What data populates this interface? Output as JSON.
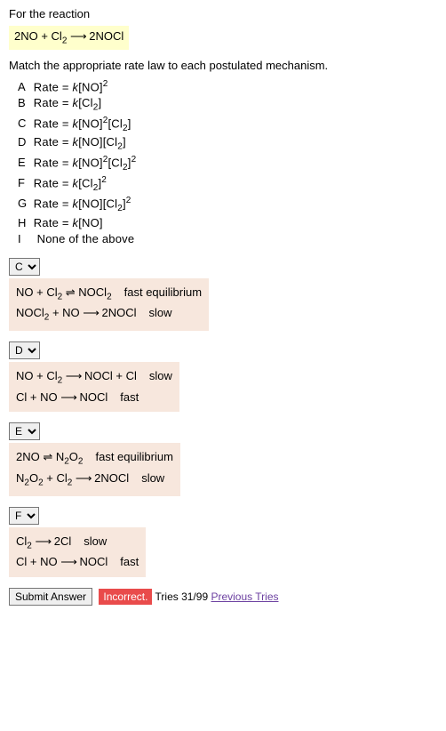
{
  "intro": "For the reaction",
  "reaction": "2NO + Cl₂ ⟶ 2NOCl",
  "instruction": "Match the appropriate rate law to each postulated mechanism.",
  "options": [
    {
      "label": "A",
      "text": "Rate = k[NO]²"
    },
    {
      "label": "B",
      "text": "Rate = k[Cl₂]"
    },
    {
      "label": "C",
      "text": "Rate = k[NO]²[Cl₂]"
    },
    {
      "label": "D",
      "text": "Rate = k[NO][Cl₂]"
    },
    {
      "label": "E",
      "text": "Rate = k[NO]²[Cl₂]²"
    },
    {
      "label": "F",
      "text": "Rate = k[Cl₂]²"
    },
    {
      "label": "G",
      "text": "Rate = k[NO][Cl₂]²"
    },
    {
      "label": "H",
      "text": "Rate = k[NO]"
    },
    {
      "label": "I",
      "text": "None of the above"
    }
  ],
  "mechanisms": [
    {
      "selected": "C",
      "lines": [
        {
          "eq": "NO + Cl₂ ⇌ NOCl₂",
          "note": "fast equilibrium"
        },
        {
          "eq": "NOCl₂ + NO ⟶ 2NOCl",
          "note": "slow"
        }
      ]
    },
    {
      "selected": "D",
      "lines": [
        {
          "eq": "NO + Cl₂ ⟶ NOCl + Cl",
          "note": "slow"
        },
        {
          "eq": "Cl + NO ⟶ NOCl",
          "note": "fast"
        }
      ]
    },
    {
      "selected": "E",
      "lines": [
        {
          "eq": "2NO ⇌ N₂O₂",
          "note": "fast equilibrium"
        },
        {
          "eq": "N₂O₂ + Cl₂ ⟶ 2NOCl",
          "note": "slow"
        }
      ]
    },
    {
      "selected": "F",
      "lines": [
        {
          "eq": "Cl₂ ⟶ 2Cl",
          "note": "slow"
        },
        {
          "eq": "Cl + NO ⟶ NOCl",
          "note": "fast"
        }
      ]
    }
  ],
  "footer": {
    "submit": "Submit Answer",
    "status": "Incorrect.",
    "tries": "Tries 31/99",
    "prev": "Previous Tries"
  }
}
